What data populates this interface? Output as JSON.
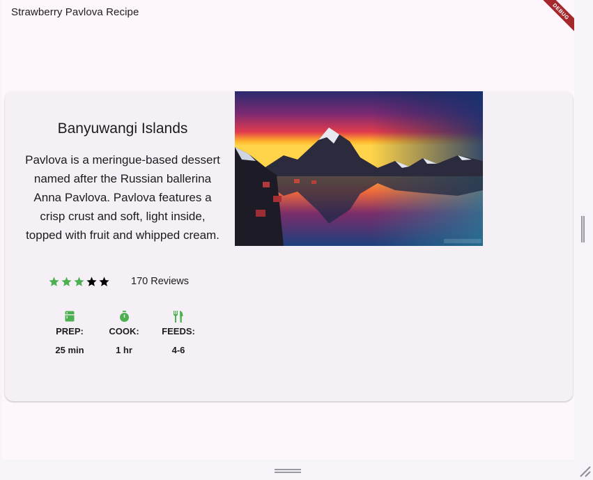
{
  "appbar": {
    "title": "Strawberry Pavlova Recipe"
  },
  "debug_banner": {
    "label": "DEBUG"
  },
  "recipe": {
    "title": "Banyuwangi Islands",
    "description": "Pavlova is a meringue-based dessert named after the Russian ballerina Anna Pavlova. Pavlova features a crisp crust and soft, light inside, topped with fruit and whipped cream.",
    "rating": {
      "filled_stars": 3,
      "total_stars": 5,
      "reviews_label": "170 Reviews"
    },
    "stats": [
      {
        "icon": "kitchen-icon",
        "label": "PREP:",
        "value": "25 min"
      },
      {
        "icon": "timer-icon",
        "label": "COOK:",
        "value": "1 hr"
      },
      {
        "icon": "restaurant-icon",
        "label": "FEEDS:",
        "value": "4-6"
      }
    ],
    "image": {
      "subject": "mountain lake at sunset"
    }
  },
  "colors": {
    "accent_green": "#4caf50",
    "star_empty": "#000000",
    "card_background": "#f5f0f5",
    "app_background": "#fdf7fd",
    "debug_banner": "#a4282c"
  }
}
